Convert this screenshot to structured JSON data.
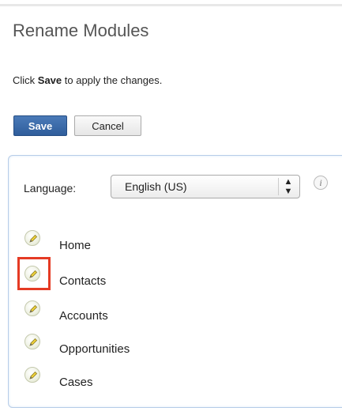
{
  "page": {
    "title": "Rename Modules",
    "instruction_prefix": "Click ",
    "instruction_bold": "Save",
    "instruction_suffix": " to apply the changes."
  },
  "toolbar": {
    "save_label": "Save",
    "cancel_label": "Cancel"
  },
  "language": {
    "label": "Language:",
    "selected": "English (US)",
    "info_glyph": "i"
  },
  "modules": [
    {
      "label": "Home",
      "icon": "pencil-icon"
    },
    {
      "label": "Contacts",
      "icon": "pencil-icon",
      "highlighted": true
    },
    {
      "label": "Accounts",
      "icon": "pencil-icon"
    },
    {
      "label": "Opportunities",
      "icon": "pencil-icon"
    },
    {
      "label": "Cases",
      "icon": "pencil-icon"
    }
  ],
  "colors": {
    "save_button": "#2f5d9b",
    "highlight": "#e53a24",
    "panel_border": "#b7cde8"
  }
}
